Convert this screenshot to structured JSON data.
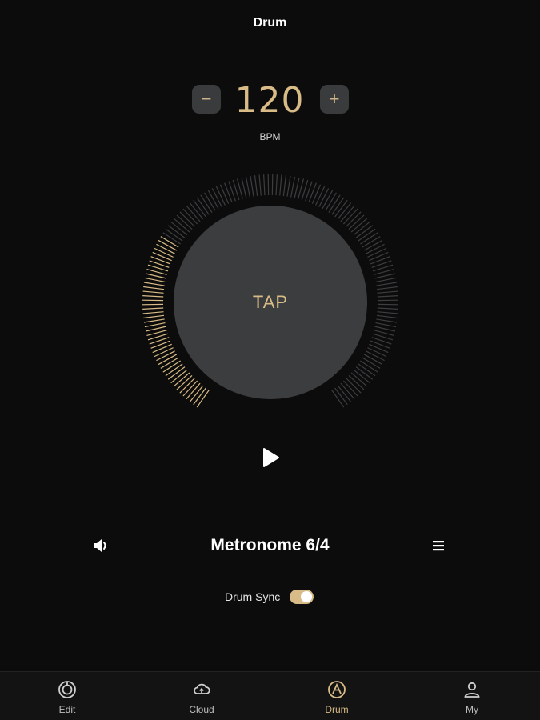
{
  "header": {
    "title": "Drum"
  },
  "tempo": {
    "bpm": "120",
    "unit": "BPM",
    "minus_symbol": "−",
    "plus_symbol": "+",
    "progress_fraction": 0.3
  },
  "dial": {
    "tap_label": "TAP"
  },
  "player": {
    "play_icon": "play-icon"
  },
  "metronome": {
    "title": "Metronome 6/4",
    "sound_icon": "speaker-icon",
    "list_icon": "list-icon"
  },
  "sync": {
    "label": "Drum Sync",
    "enabled": true
  },
  "nav": {
    "items": [
      {
        "label": "Edit",
        "icon": "edit-dial-icon",
        "active": false
      },
      {
        "label": "Cloud",
        "icon": "cloud-icon",
        "active": false
      },
      {
        "label": "Drum",
        "icon": "drum-icon",
        "active": true
      },
      {
        "label": "My",
        "icon": "user-icon",
        "active": false
      }
    ]
  },
  "colors": {
    "accent": "#d8bb87",
    "background": "#0c0c0c",
    "button": "#3c3d3f",
    "inactive_tick": "#3d3e40"
  }
}
